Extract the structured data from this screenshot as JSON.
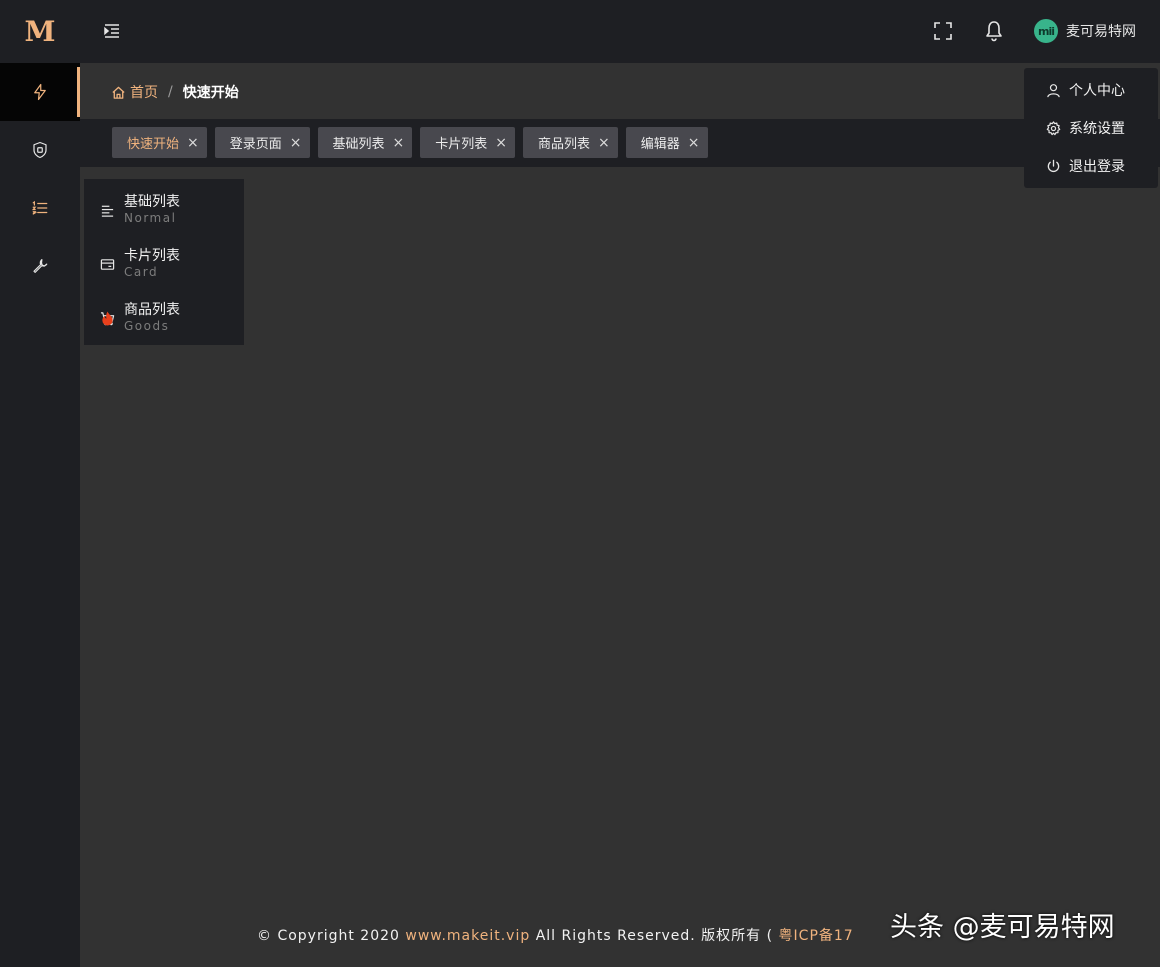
{
  "app": {
    "logo_text": "M"
  },
  "sidebar": {
    "items": [
      {
        "icon": "lightning-icon",
        "active": true
      },
      {
        "icon": "shield-icon",
        "active": false
      },
      {
        "icon": "ordered-list-icon",
        "active": false
      },
      {
        "icon": "wrench-icon",
        "active": false
      }
    ]
  },
  "header": {
    "user": {
      "avatar_text": "mii",
      "name": "麦可易特网"
    },
    "icons": [
      "menu-indent-icon",
      "fullscreen-icon",
      "bell-icon"
    ]
  },
  "breadcrumb": {
    "home": "首页",
    "separator": "/",
    "current": "快速开始"
  },
  "tabs": [
    {
      "label": "快速开始",
      "active": true
    },
    {
      "label": "登录页面",
      "active": false
    },
    {
      "label": "基础列表",
      "active": false
    },
    {
      "label": "卡片列表",
      "active": false
    },
    {
      "label": "商品列表",
      "active": false
    },
    {
      "label": "编辑器",
      "active": false
    }
  ],
  "tab_close_glyph": "×",
  "submenu": {
    "items": [
      {
        "title": "基础列表",
        "subtitle": "Normal",
        "icon": "align-left-icon"
      },
      {
        "title": "卡片列表",
        "subtitle": "Card",
        "icon": "credit-card-icon"
      },
      {
        "title": "商品列表",
        "subtitle": "Goods",
        "icon": "cart-icon",
        "badge": "fire-icon"
      }
    ]
  },
  "dropdown": {
    "items": [
      {
        "label": "个人中心",
        "icon": "user-icon"
      },
      {
        "label": "系统设置",
        "icon": "gear-icon"
      },
      {
        "label": "退出登录",
        "icon": "power-icon"
      }
    ]
  },
  "footer": {
    "prefix": "© Copyright 2020 ",
    "site": "www.makeit.vip",
    "middle": " All Rights Reserved. 版权所有 ( ",
    "icp": "粤ICP备17"
  },
  "watermark": "头条 @麦可易特网",
  "colors": {
    "accent": "#f0b37e",
    "sidebar_bg": "#1e1f23",
    "content_bg": "#323232",
    "fire": "#e8401c",
    "avatar": "#38b48b"
  }
}
